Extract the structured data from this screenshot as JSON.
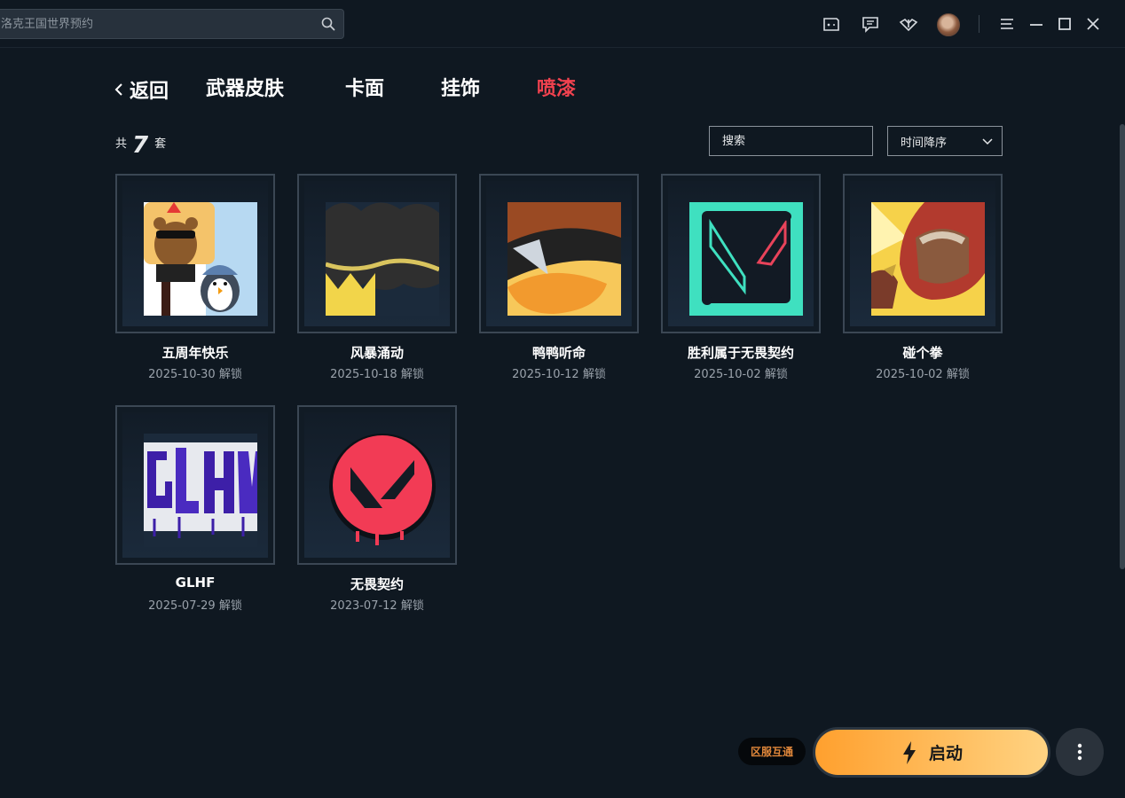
{
  "topbar": {
    "search_placeholder": "洛克王国世界预约",
    "icons": [
      "gamepad-icon",
      "message-icon",
      "valorant-icon",
      "avatar",
      "menu-icon",
      "minimize-icon",
      "maximize-icon",
      "close-icon"
    ]
  },
  "nav": {
    "back_label": "返回",
    "tabs": [
      {
        "label": "武器皮肤",
        "active": false
      },
      {
        "label": "卡面",
        "active": false
      },
      {
        "label": "挂饰",
        "active": false
      },
      {
        "label": "喷漆",
        "active": true
      }
    ]
  },
  "summary": {
    "prefix": "共",
    "count": "7",
    "suffix": "套"
  },
  "filters": {
    "search_placeholder": "搜索",
    "sort_label": "时间降序"
  },
  "sprays": [
    {
      "name": "五周年快乐",
      "date": "2025-10-30 解锁",
      "art": "happy-fifth-anniversary-spray"
    },
    {
      "name": "风暴涌动",
      "date": "2025-10-18 解锁",
      "art": "storm-surge-spray"
    },
    {
      "name": "鸭鸭听命",
      "date": "2025-10-12 解锁",
      "art": "duck-sunglasses-spray"
    },
    {
      "name": "胜利属于无畏契约",
      "date": "2025-10-02 解锁",
      "art": "victory-valorant-spray"
    },
    {
      "name": "碰个拳",
      "date": "2025-10-02 解锁",
      "art": "fist-bump-spray"
    },
    {
      "name": "GLHF",
      "date": "2025-07-29 解锁",
      "art": "glhf-graffiti-spray"
    },
    {
      "name": "无畏契约",
      "date": "2023-07-12 解锁",
      "art": "valorant-logo-spray"
    }
  ],
  "bottom": {
    "region_label": "区服互通",
    "launch_label": "启动"
  },
  "colors": {
    "background": "#0f1821",
    "active_tab": "#f2424f",
    "launch_gradient_start": "#ffa02e",
    "launch_gradient_end": "#ffd382",
    "region_text": "#e0873a"
  }
}
